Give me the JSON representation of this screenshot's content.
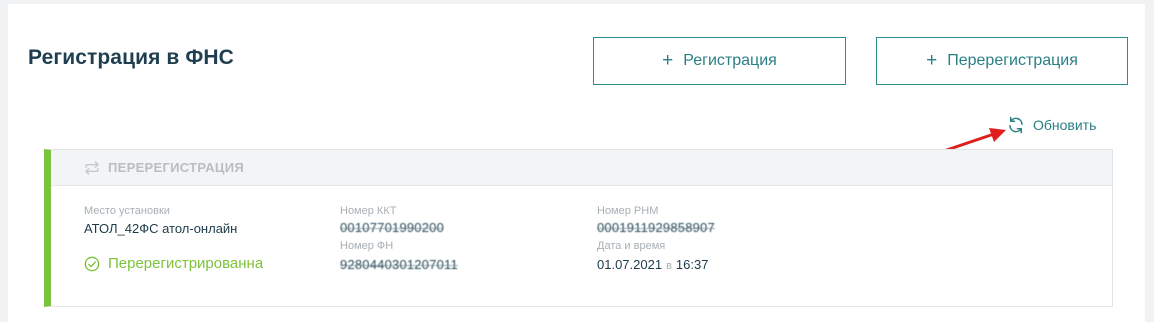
{
  "header": {
    "title": "Регистрация в ФНС",
    "register_button": "Регистрация",
    "reregister_button": "Перерегистрация",
    "plus_symbol": "+",
    "refresh_label": "Обновить"
  },
  "card": {
    "type_title": "ПЕРЕРЕГИСТРАЦИЯ",
    "accent_color": "#7dc23b",
    "install_place_label": "Место установки",
    "install_place_value": "АТОЛ_42ФС атол-онлайн",
    "status": "Перерегистрированна",
    "kkt_number_label": "Номер ККТ",
    "kkt_number_value": "00107701990200",
    "fn_number_label": "Номер ФН",
    "fn_number_value": "9280440301207011",
    "rnm_label": "Номер РНМ",
    "rnm_value": "0001911929858907",
    "datetime_label": "Дата и время",
    "date_value": "01.07.2021",
    "date_time_separator": "в",
    "time_value": "16:37"
  },
  "colors": {
    "accent_teal": "#2a8f8a",
    "success_green": "#7dc23b",
    "annotation_arrow": "#e01e1e"
  },
  "icons": [
    "plus-icon",
    "refresh-icon",
    "swap-icon",
    "check-circle-icon"
  ]
}
